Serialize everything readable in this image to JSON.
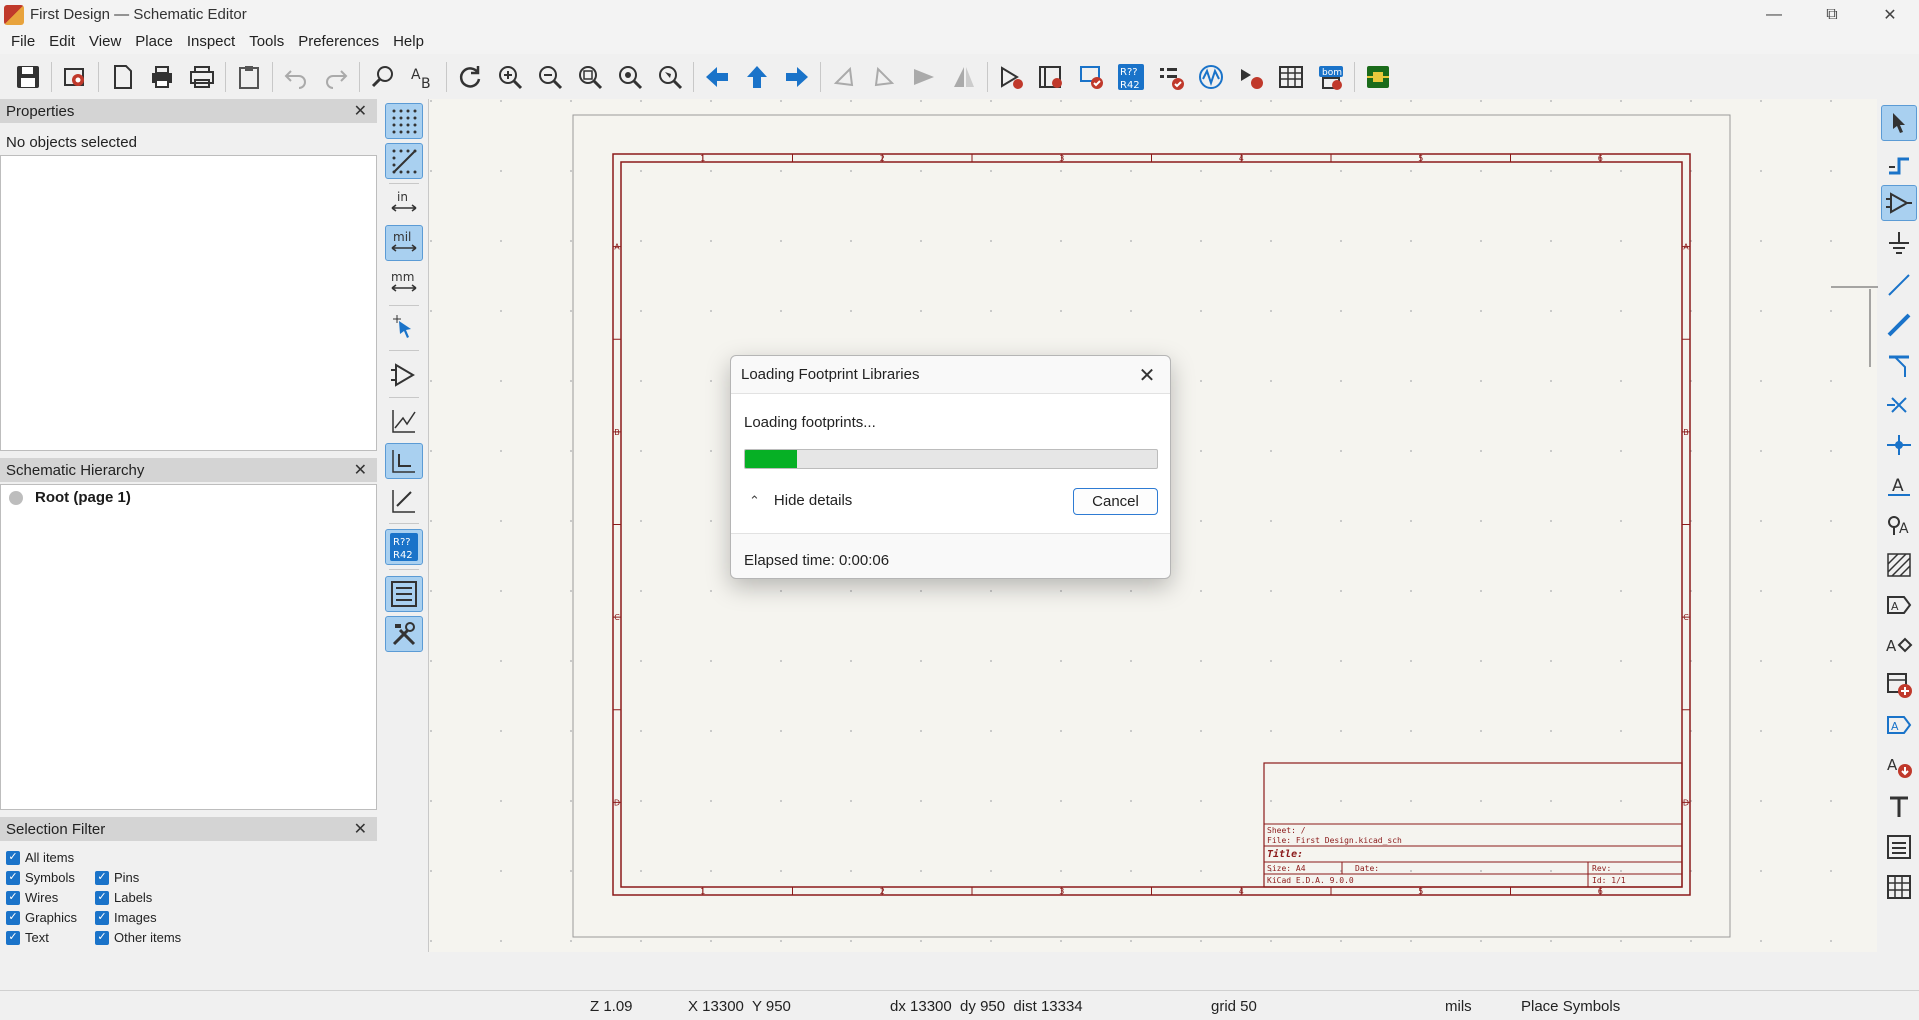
{
  "window": {
    "title": "First Design — Schematic Editor",
    "controls": [
      "minimize-icon",
      "restore-icon",
      "close-icon"
    ]
  },
  "menu": [
    "File",
    "Edit",
    "View",
    "Place",
    "Inspect",
    "Tools",
    "Preferences",
    "Help"
  ],
  "properties": {
    "title": "Properties",
    "status": "No objects selected"
  },
  "hierarchy": {
    "title": "Schematic Hierarchy",
    "root_label": "Root (page 1)"
  },
  "selection_filter": {
    "title": "Selection Filter",
    "items": [
      {
        "label": "All items",
        "checked": true
      },
      {
        "label": "Symbols",
        "checked": true
      },
      {
        "label": "Pins",
        "checked": true
      },
      {
        "label": "Wires",
        "checked": true
      },
      {
        "label": "Labels",
        "checked": true
      },
      {
        "label": "Graphics",
        "checked": true
      },
      {
        "label": "Images",
        "checked": true
      },
      {
        "label": "Text",
        "checked": true
      },
      {
        "label": "Other items",
        "checked": true
      }
    ]
  },
  "vtoolbar": {
    "units_in": "in",
    "units_mil": "mil",
    "units_mm": "mm",
    "annotate_top": "R??",
    "annotate_bottom": "R42"
  },
  "toolbar": {
    "annotate_top": "R??",
    "annotate_bottom": "R42",
    "bom": "bom"
  },
  "sheet": {
    "col_labels": [
      "1",
      "2",
      "3",
      "4",
      "5",
      "6"
    ],
    "row_labels": [
      "A",
      "B",
      "C",
      "D"
    ],
    "title_block": {
      "sheet": "Sheet: /",
      "file": "File: First Design.kicad_sch",
      "title": "Title:",
      "size": "Size: A4",
      "date": "Date:",
      "rev": "Rev:",
      "app": "KiCad E.D.A. 9.0.0",
      "id": "Id: 1/1"
    }
  },
  "dialog": {
    "title": "Loading Footprint Libraries",
    "message": "Loading footprints...",
    "progress": 0.125,
    "details_label": "Hide details",
    "cancel_label": "Cancel",
    "elapsed": "Elapsed time: 0:00:06",
    "progress_color": "#06b025"
  },
  "status": {
    "zoom": "Z 1.09",
    "coords": "X 13300  Y 950",
    "delta": "dx 13300  dy 950  dist 13334",
    "grid": "grid 50",
    "units": "mils",
    "tool": "Place Symbols"
  },
  "colors": {
    "sheet_border": "#8b1a1a",
    "accent": "#1a73c9",
    "active_bg": "#a9d0f0"
  }
}
